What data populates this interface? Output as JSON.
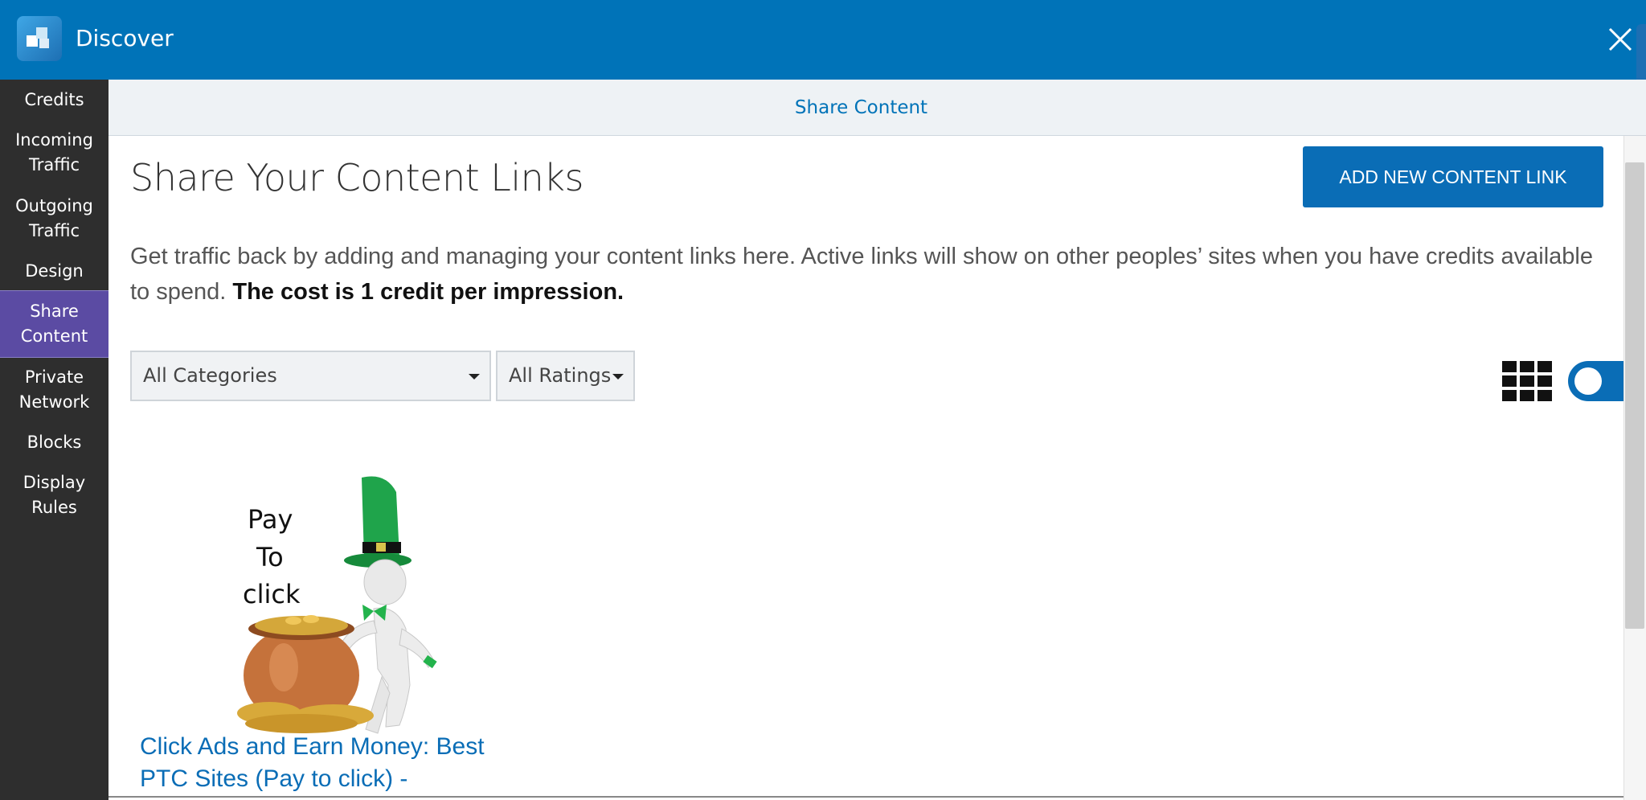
{
  "app": {
    "title": "Discover"
  },
  "sidebar": {
    "items": [
      {
        "label": "Credits"
      },
      {
        "label": "Incoming Traffic"
      },
      {
        "label": "Outgoing Traffic"
      },
      {
        "label": "Design"
      },
      {
        "label": "Share Content",
        "active": true
      },
      {
        "label": "Private Network"
      },
      {
        "label": "Blocks"
      },
      {
        "label": "Display Rules"
      }
    ]
  },
  "tabbar": {
    "label": "Share Content"
  },
  "main": {
    "title": "Share Your Content Links",
    "add_button": "ADD NEW CONTENT LINK",
    "description": "Get traffic back by adding and managing your content links here. Active links will show on other peoples’ sites when you have credits available to spend. ",
    "description_bold": "The cost is 1 credit per impression.",
    "filters": {
      "category": "All Categories",
      "rating": "All Ratings"
    },
    "view_toggle": {
      "mode": "grid"
    },
    "card": {
      "image_text": [
        "Pay",
        "To",
        "click"
      ],
      "title": "Click Ads and Earn Money: Best PTC Sites (Pay to click) -"
    }
  },
  "colors": {
    "brand_blue": "#0073b8",
    "sidebar_bg": "#2e2e2e",
    "active_nav": "#5b4ba3",
    "link_blue": "#0a6db6"
  }
}
